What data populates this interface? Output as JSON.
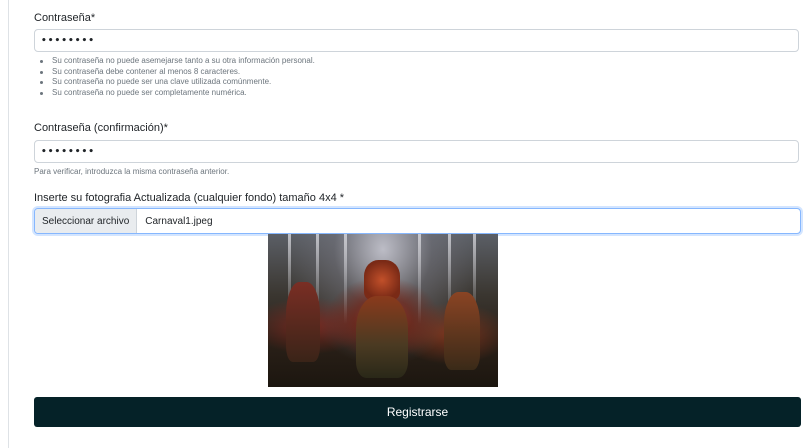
{
  "password": {
    "label": "Contraseña*",
    "value": "••••••••",
    "help": [
      "Su contraseña no puede asemejarse tanto a su otra información personal.",
      "Su contraseña debe contener al menos 8 caracteres.",
      "Su contraseña no puede ser una clave utilizada comúnmente.",
      "Su contraseña no puede ser completamente numérica."
    ]
  },
  "password_confirm": {
    "label": "Contraseña (confirmación)*",
    "value": "••••••••",
    "help": "Para verificar, introduzca la misma contraseña anterior."
  },
  "photo_upload": {
    "label": "Inserte su fotografia Actualizada (cualquier fondo) tamaño 4x4 *",
    "button_label": "Seleccionar archivo",
    "file_name": "Carnaval1.jpeg"
  },
  "submit": {
    "label": "Registrarse"
  },
  "colors": {
    "submit_bg": "#052228",
    "focus_border": "#86b7fe",
    "help_text": "#6c757d"
  }
}
